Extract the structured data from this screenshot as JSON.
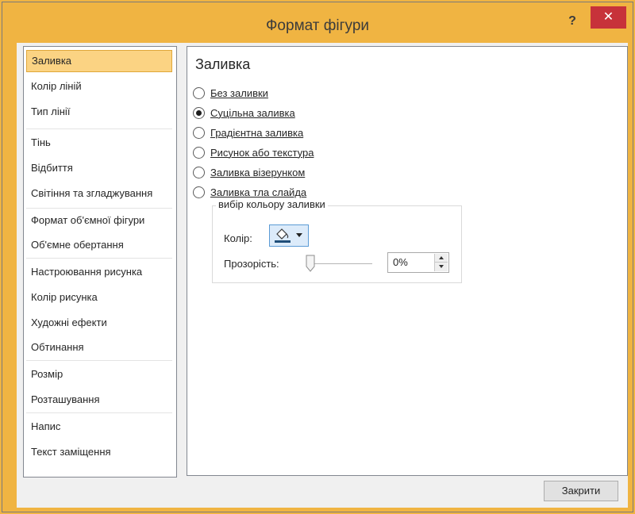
{
  "window": {
    "title": "Формат фігури",
    "help_label": "?",
    "close_label": "✕",
    "accent_color": "#f0b442",
    "close_color": "#c7323a"
  },
  "sidebar": {
    "items": [
      {
        "label": "Заливка",
        "selected": true
      },
      {
        "label": "Колір ліній"
      },
      {
        "label": "Тип лінії"
      },
      {
        "label": "Тінь"
      },
      {
        "label": "Відбиття"
      },
      {
        "label": "Світіння та згладжування"
      },
      {
        "label": "Формат об'ємної фігури"
      },
      {
        "label": "Об'ємне обертання"
      },
      {
        "label": "Настроювання рисунка"
      },
      {
        "label": "Колір рисунка"
      },
      {
        "label": "Художні ефекти"
      },
      {
        "label": "Обтинання"
      },
      {
        "label": "Розмір"
      },
      {
        "label": "Розташування"
      },
      {
        "label": "Напис"
      },
      {
        "label": "Текст заміщення"
      }
    ]
  },
  "panel": {
    "title": "Заливка",
    "options": [
      {
        "label": "Без заливки",
        "checked": false
      },
      {
        "label": "Суцільна заливка",
        "checked": true
      },
      {
        "label": "Градієнтна заливка",
        "checked": false
      },
      {
        "label": "Рисунок або текстура",
        "checked": false
      },
      {
        "label": "Заливка візерунком",
        "checked": false
      },
      {
        "label": "Заливка тла слайда",
        "checked": false
      }
    ],
    "group": {
      "legend": "вибір кольору заливки",
      "color_label": "Колір:",
      "transparency_label": "Прозорість:",
      "transparency_value": "0%",
      "transparency_level": 0
    }
  },
  "footer": {
    "close_button": "Закрити"
  }
}
